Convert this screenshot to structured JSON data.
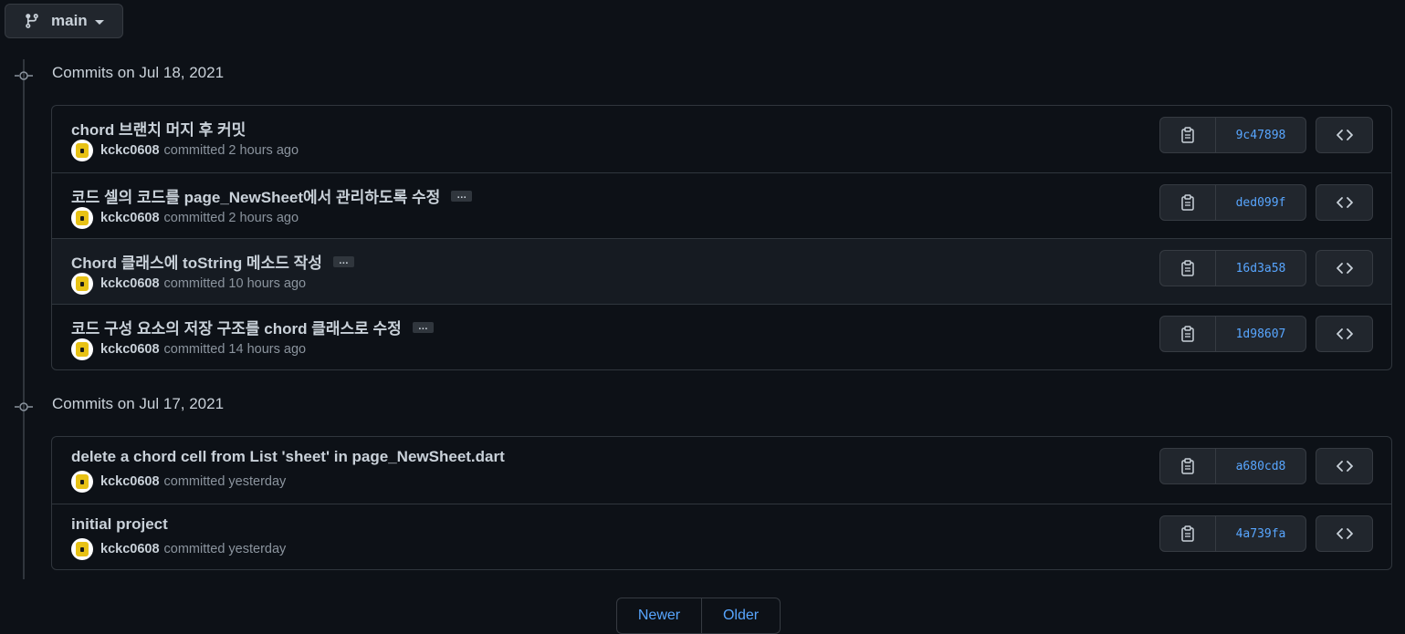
{
  "branch": {
    "label": "main"
  },
  "groups": [
    {
      "title": "Commits on Jul 18, 2021",
      "commits": [
        {
          "message": "chord 브랜치 머지 후 커밋",
          "has_ellipsis": false,
          "author": "kckc0608",
          "when": "committed 2 hours ago",
          "sha": "9c47898"
        },
        {
          "message": "코드 셀의 코드를 page_NewSheet에서 관리하도록 수정",
          "has_ellipsis": true,
          "author": "kckc0608",
          "when": "committed 2 hours ago",
          "sha": "ded099f"
        },
        {
          "message": "Chord 클래스에 toString 메소드 작성",
          "has_ellipsis": true,
          "author": "kckc0608",
          "when": "committed 10 hours ago",
          "sha": "16d3a58"
        },
        {
          "message": "코드 구성 요소의 저장 구조를 chord 클래스로 수정",
          "has_ellipsis": true,
          "author": "kckc0608",
          "when": "committed 14 hours ago",
          "sha": "1d98607"
        }
      ]
    },
    {
      "title": "Commits on Jul 17, 2021",
      "commits": [
        {
          "message": "delete a chord cell from List 'sheet' in page_NewSheet.dart",
          "has_ellipsis": false,
          "author": "kckc0608",
          "when": "committed yesterday",
          "sha": "a680cd8"
        },
        {
          "message": "initial project",
          "has_ellipsis": false,
          "author": "kckc0608",
          "when": "committed yesterday",
          "sha": "4a739fa"
        }
      ]
    }
  ],
  "ellipsis_label": "…",
  "pagination": {
    "newer": "Newer",
    "older": "Older"
  },
  "colors": {
    "background": "#0d1117",
    "border": "#30363d",
    "link": "#58a6ff",
    "text": "#c9d1d9",
    "muted": "#8b949e"
  }
}
